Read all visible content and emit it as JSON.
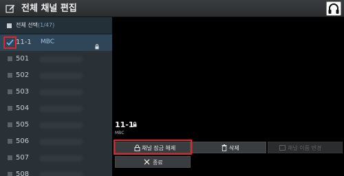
{
  "header": {
    "title": "전체 채널 편집",
    "icon": "edit-icon"
  },
  "sidebar": {
    "select_all": {
      "label": "전체 선택",
      "count": "(1/47)"
    },
    "channels": [
      {
        "number": "11-1",
        "name": "MBC",
        "locked": true,
        "selected": true
      },
      {
        "number": "501",
        "name": "",
        "locked": false,
        "selected": false
      },
      {
        "number": "502",
        "name": "",
        "locked": false,
        "selected": false
      },
      {
        "number": "503",
        "name": "",
        "locked": false,
        "selected": false
      },
      {
        "number": "504",
        "name": "",
        "locked": false,
        "selected": false
      },
      {
        "number": "505",
        "name": "",
        "locked": false,
        "selected": false
      },
      {
        "number": "506",
        "name": "",
        "locked": false,
        "selected": false
      },
      {
        "number": "507",
        "name": "",
        "locked": false,
        "selected": false
      },
      {
        "number": "508",
        "name": "",
        "locked": false,
        "selected": false
      }
    ]
  },
  "info": {
    "number": "11-1",
    "name": "MBC"
  },
  "actions": {
    "unlock": "채널 잠금 해제",
    "delete": "삭제",
    "rename": "채널 이름 변경",
    "close": "종료"
  },
  "colors": {
    "highlight": "#e0262b",
    "selected_row": "#2f4658",
    "accent": "#9dc3e6"
  }
}
